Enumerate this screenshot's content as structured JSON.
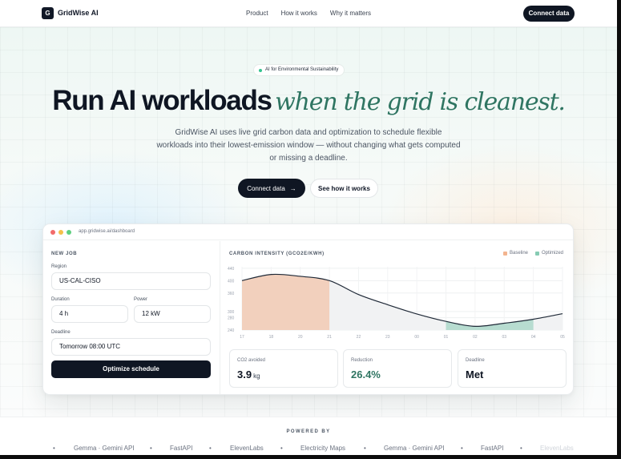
{
  "brand": {
    "logo_letter": "G",
    "name": "GridWise AI"
  },
  "nav": {
    "links": [
      "Product",
      "How it works",
      "Why it matters"
    ],
    "cta": "Connect data"
  },
  "hero": {
    "badge": "AI for Environmental Sustainability",
    "headline_bold": "Run AI workloads",
    "headline_italic": "when the grid is cleanest.",
    "subcopy": "GridWise AI uses live grid carbon data and optimization to schedule flexible workloads into their lowest-emission window — without changing what gets computed or missing a deadline.",
    "primary_button": "Connect data",
    "primary_arrow": "→",
    "secondary_button": "See how it works"
  },
  "dashboard": {
    "url": "app.gridwise.ai/dashboard",
    "window_dot_colors": [
      "#f26b6b",
      "#f5c04a",
      "#5fcf80"
    ],
    "new_job": {
      "title": "NEW JOB",
      "region_label": "Region",
      "region_value": "US-CAL-CISO",
      "duration_label": "Duration",
      "duration_value": "4 h",
      "power_label": "Power",
      "power_value": "12 kW",
      "deadline_label": "Deadline",
      "deadline_value": "Tomorrow 08:00 UTC",
      "button": "Optimize schedule"
    },
    "chart_title": "CARBON INTENSITY (GCO2E/KWH)",
    "stats": [
      {
        "label": "CO2 avoided",
        "value": "3.9",
        "unit": "kg",
        "color": "#0f1623"
      },
      {
        "label": "Reduction",
        "value": "26.4%",
        "unit": "",
        "color": "#2f7562"
      },
      {
        "label": "Deadline",
        "value": "Met",
        "unit": "",
        "color": "#0f1623"
      }
    ]
  },
  "chart_data": {
    "type": "line",
    "title": "CARBON INTENSITY (GCO2E/KWH)",
    "xlabel": "",
    "ylabel": "",
    "x": [
      "17",
      "18",
      "20",
      "21",
      "22",
      "23",
      "00",
      "01",
      "02",
      "03",
      "04",
      "05"
    ],
    "series": [
      {
        "values": [
          400,
          420,
          414,
          400,
          355,
          322,
          292,
          268,
          252,
          262,
          275,
          293
        ]
      }
    ],
    "ylim": [
      240,
      445
    ],
    "yticks": [
      240,
      280,
      300,
      360,
      400,
      440
    ],
    "highlights": [
      {
        "name": "Baseline",
        "from": "17",
        "to": "21",
        "color": "#f3b48f"
      },
      {
        "name": "Optimized",
        "from": "01",
        "to": "04",
        "color": "#86cbb3"
      }
    ],
    "legend": [
      "Baseline",
      "Optimized"
    ],
    "legend_position": "top-right",
    "grid": true,
    "line_color": "#1f2937"
  },
  "powered_by": {
    "title": "POWERED BY",
    "items": [
      "Gemma · Gemini API",
      "FastAPI",
      "ElevenLabs",
      "Electricity Maps",
      "Gemma · Gemini API",
      "FastAPI",
      "ElevenLabs"
    ],
    "separator": "•"
  }
}
